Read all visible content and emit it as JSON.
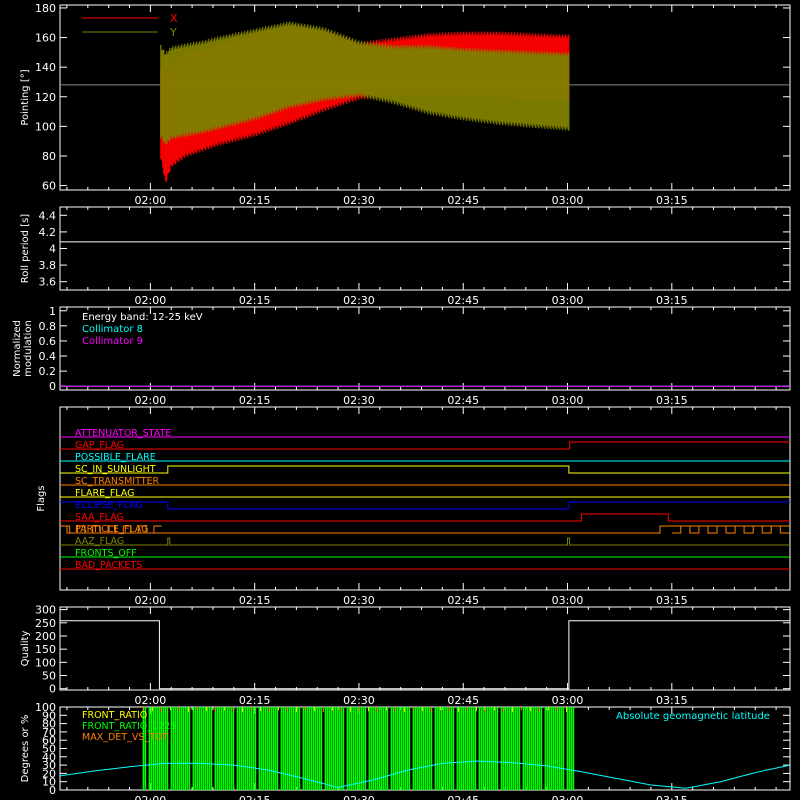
{
  "x_axis": {
    "ticks": [
      "02:00",
      "02:15",
      "02:30",
      "02:45",
      "03:00",
      "03:15"
    ],
    "tick_minutes": [
      120,
      135,
      150,
      165,
      180,
      195
    ],
    "range_minutes": [
      107,
      212
    ]
  },
  "colors": {
    "background": "#000000",
    "axes": "#ffffff",
    "x": "#ff0000",
    "y": "#808000",
    "cyan": "#00ffff",
    "magenta": "#ff00ff",
    "green": "#00ff00",
    "orange": "#ff8000",
    "yellow": "#ffff00",
    "blue": "#0000ff",
    "gray": "#888888"
  },
  "chart_data": [
    {
      "id": "pointing",
      "type": "area",
      "ylabel": "Pointing [°]",
      "ylim": [
        57,
        182
      ],
      "yticks": [
        60,
        80,
        100,
        120,
        140,
        160,
        180
      ],
      "legend": {
        "placement": "top-left",
        "entries": [
          {
            "name": "X",
            "color": "#ff0000"
          },
          {
            "name": "Y",
            "color": "#808000"
          }
        ]
      },
      "reference_line": 128,
      "series": [
        {
          "name": "X",
          "color": "#ff0000",
          "x": [
            121.5,
            122.2,
            123,
            125,
            127.5,
            130,
            135,
            140,
            145,
            150,
            155,
            160,
            165,
            170,
            175,
            180.2
          ],
          "upper": [
            140,
            150,
            142,
            150,
            152,
            156,
            163,
            168,
            165,
            157,
            160,
            163,
            164,
            164,
            163,
            162
          ],
          "lower": [
            78,
            61,
            72,
            79,
            83,
            87,
            93,
            101,
            110,
            118,
            120,
            121,
            120,
            119,
            118,
            117
          ]
        },
        {
          "name": "Y",
          "color": "#808000",
          "x": [
            121.5,
            122.2,
            123,
            125,
            127.5,
            130,
            135,
            140,
            145,
            150,
            155,
            160,
            165,
            170,
            175,
            180.2
          ],
          "upper": [
            155,
            150,
            154,
            156,
            158,
            161,
            166,
            171,
            167,
            158,
            155,
            155,
            153,
            152,
            151,
            150
          ],
          "lower": [
            92,
            87,
            91,
            93,
            95,
            98,
            104,
            112,
            117,
            120,
            115,
            108,
            104,
            101,
            99,
            97
          ]
        }
      ]
    },
    {
      "id": "roll",
      "type": "line",
      "ylabel": "Roll period [s]",
      "ylim": [
        3.5,
        4.5
      ],
      "yticks": [
        3.6,
        3.8,
        4.0,
        4.2,
        4.4
      ],
      "series": [
        {
          "x": [
            107,
            212
          ],
          "y": [
            4.08,
            4.08
          ],
          "color": "#ffffff"
        }
      ]
    },
    {
      "id": "modulation",
      "type": "line",
      "ylabel": "Normalized\nmodulation",
      "ylim": [
        -0.05,
        1.05
      ],
      "yticks": [
        0.0,
        0.2,
        0.4,
        0.6,
        0.8,
        1.0
      ],
      "annotations": [
        {
          "text": "Energy band: 12-25 keV",
          "color": "#ffffff"
        },
        {
          "text": "Collimator 8",
          "color": "#00ffff"
        },
        {
          "text": "Collimator 9",
          "color": "#ff00ff"
        }
      ],
      "series": [
        {
          "name": "Collimator 8",
          "x": [
            107,
            212
          ],
          "y": [
            0,
            0
          ],
          "color": "#00ffff"
        },
        {
          "name": "Collimator 9",
          "x": [
            107,
            212
          ],
          "y": [
            0,
            0
          ],
          "color": "#ff00ff"
        }
      ]
    },
    {
      "id": "flags",
      "type": "line",
      "ylabel": "Flags",
      "flags": [
        {
          "name": "ATTENUATOR_STATE",
          "color": "#ff00ff",
          "segments": [
            [
              107,
              212,
              0
            ]
          ]
        },
        {
          "name": "GAP_FLAG",
          "color": "#ff0000",
          "segments": [
            [
              107,
              180.3,
              0
            ],
            [
              180.3,
              212,
              1
            ]
          ]
        },
        {
          "name": "POSSIBLE_FLARE",
          "color": "#00ffff",
          "segments": [
            [
              107,
              212,
              0
            ]
          ]
        },
        {
          "name": "SC_IN_SUNLIGHT",
          "color": "#ffff00",
          "segments": [
            [
              107,
              122.5,
              0
            ],
            [
              122.5,
              180.2,
              1
            ],
            [
              180.2,
              212,
              0
            ]
          ]
        },
        {
          "name": "SC_TRANSMITTER",
          "color": "#ff8000",
          "segments": [
            [
              107,
              212,
              0
            ]
          ]
        },
        {
          "name": "FLARE_FLAG",
          "color": "#ffff00",
          "segments": [
            [
              107,
              212,
              0
            ]
          ]
        },
        {
          "name": "ECLIPSE_FLAG",
          "color": "#0000ff",
          "segments": [
            [
              107,
              122.5,
              1
            ],
            [
              122.5,
              180.2,
              0
            ],
            [
              180.2,
              212,
              1
            ]
          ]
        },
        {
          "name": "SAA_FLAG",
          "color": "#ff0000",
          "segments": [
            [
              107,
              182,
              0
            ],
            [
              182,
              194.5,
              1
            ],
            [
              194.5,
              212,
              0
            ]
          ]
        },
        {
          "name": "PARTICLE_FLAG",
          "color": "#ff8000",
          "segments": [
            [
              107,
              108,
              1
            ],
            [
              108,
              193.3,
              0
            ],
            [
              193.3,
              212,
              1
            ]
          ]
        },
        {
          "name": "AAZ_FLAG",
          "color": "#808000",
          "segments": [
            [
              107,
              122.5,
              0
            ],
            [
              122.5,
              122.8,
              1
            ],
            [
              122.8,
              180,
              0
            ],
            [
              180,
              180.3,
              1
            ],
            [
              180.3,
              212,
              0
            ]
          ]
        },
        {
          "name": "FRONTS_OFF",
          "color": "#00ff00",
          "segments": [
            [
              107,
              212,
              0
            ]
          ]
        },
        {
          "name": "BAD_PACKETS",
          "color": "#ff0000",
          "segments": [
            [
              107,
              212,
              0
            ]
          ]
        }
      ]
    },
    {
      "id": "quality",
      "type": "line",
      "ylabel": "Quality",
      "ylim": [
        -5,
        310
      ],
      "yticks": [
        0,
        50,
        100,
        150,
        200,
        250,
        300
      ],
      "series": [
        {
          "x": [
            107,
            121.3,
            121.3,
            180.2,
            180.2,
            212
          ],
          "y": [
            258,
            258,
            0,
            0,
            258,
            258
          ],
          "color": "#ffffff"
        }
      ]
    },
    {
      "id": "ratios",
      "type": "line",
      "ylabel": "Degrees or %",
      "ylim": [
        0,
        100
      ],
      "yticks": [
        0,
        10,
        20,
        30,
        40,
        50,
        60,
        70,
        80,
        90,
        100
      ],
      "legend_left": [
        {
          "name": "FRONT_RATIO",
          "color": "#ffff00"
        },
        {
          "name": "FRONT_RATIO_1225",
          "color": "#00ff00"
        },
        {
          "name": "MAX_DET_VS_TOT",
          "color": "#ff8000"
        }
      ],
      "legend_right": {
        "name": "Absolute geomagnetic latitude",
        "color": "#00ffff"
      },
      "green_band": [
        119,
        181
      ],
      "series": [
        {
          "name": "Absolute geomagnetic latitude",
          "color": "#00ffff",
          "x": [
            107,
            112,
            117,
            122,
            127,
            132,
            137,
            142,
            147,
            152,
            157,
            162,
            167,
            172,
            177,
            182,
            187,
            192,
            197,
            202,
            207,
            212
          ],
          "y": [
            17,
            23,
            28,
            32,
            32,
            30,
            24,
            14,
            3,
            12,
            24,
            32,
            35,
            33,
            29,
            22,
            14,
            6,
            2,
            10,
            21,
            30
          ]
        }
      ]
    }
  ]
}
